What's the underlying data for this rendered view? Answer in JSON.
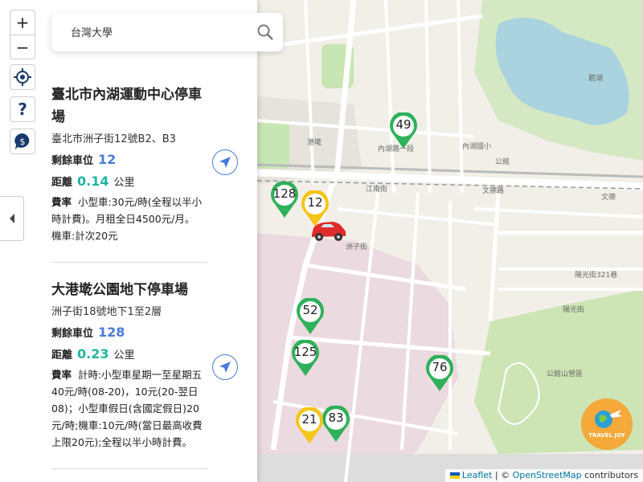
{
  "search": {
    "value": "台灣大學"
  },
  "zoom": {
    "in": "+",
    "out": "−"
  },
  "controls": {
    "help": "?"
  },
  "collapse_icon": "chevron-left-icon",
  "parking": [
    {
      "name": "臺北市內湖運動中心停車場",
      "address": "臺北市洲子街12號B2、B3",
      "spaces_label": "剩餘車位",
      "spaces": "12",
      "distance_label": "距離",
      "distance": "0.14",
      "distance_unit": "公里",
      "rate_label": "費率",
      "rate": "小型車:30元/時(全程以半小時計費)。月租全日4500元/月。 機車:計次20元"
    },
    {
      "name": "大港墘公園地下停車場",
      "address": "洲子街18號地下1至2層",
      "spaces_label": "剩餘車位",
      "spaces": "128",
      "distance_label": "距離",
      "distance": "0.23",
      "distance_unit": "公里",
      "rate_label": "費率",
      "rate": "計時:小型車星期一至星期五40元/時(08-20)，10元(20-翌日08)；小型車假日(含國定假日)20元/時;機車:10元/時(當日最高收費上限20元);全程以半小時計費。"
    }
  ],
  "map": {
    "markers": [
      {
        "label": "49",
        "color": "#2fb05a"
      },
      {
        "label": "128",
        "color": "#2fb05a"
      },
      {
        "label": "12",
        "color": "#f5c518"
      },
      {
        "label": "52",
        "color": "#2fb05a"
      },
      {
        "label": "125",
        "color": "#2fb05a"
      },
      {
        "label": "76",
        "color": "#2fb05a"
      },
      {
        "label": "21",
        "color": "#f5c518"
      },
      {
        "label": "83",
        "color": "#2fb05a"
      }
    ],
    "labels": {
      "l1": "內湖路一段",
      "l2": "文德路",
      "l3": "碧湖",
      "l4": "文德",
      "l5": "公館山營區",
      "l6": "內湖國小",
      "l7": "陽光街",
      "l8": "陽光街321巷",
      "l9": "港墘",
      "l10": "江南街",
      "l11": "洲子街",
      "l12": "公館"
    },
    "logo_text": "TRAVEL JOY"
  },
  "attribution": {
    "leaflet": "Leaflet",
    "sep": " | © ",
    "osm": "OpenStreetMap",
    "rest": " contributors"
  }
}
